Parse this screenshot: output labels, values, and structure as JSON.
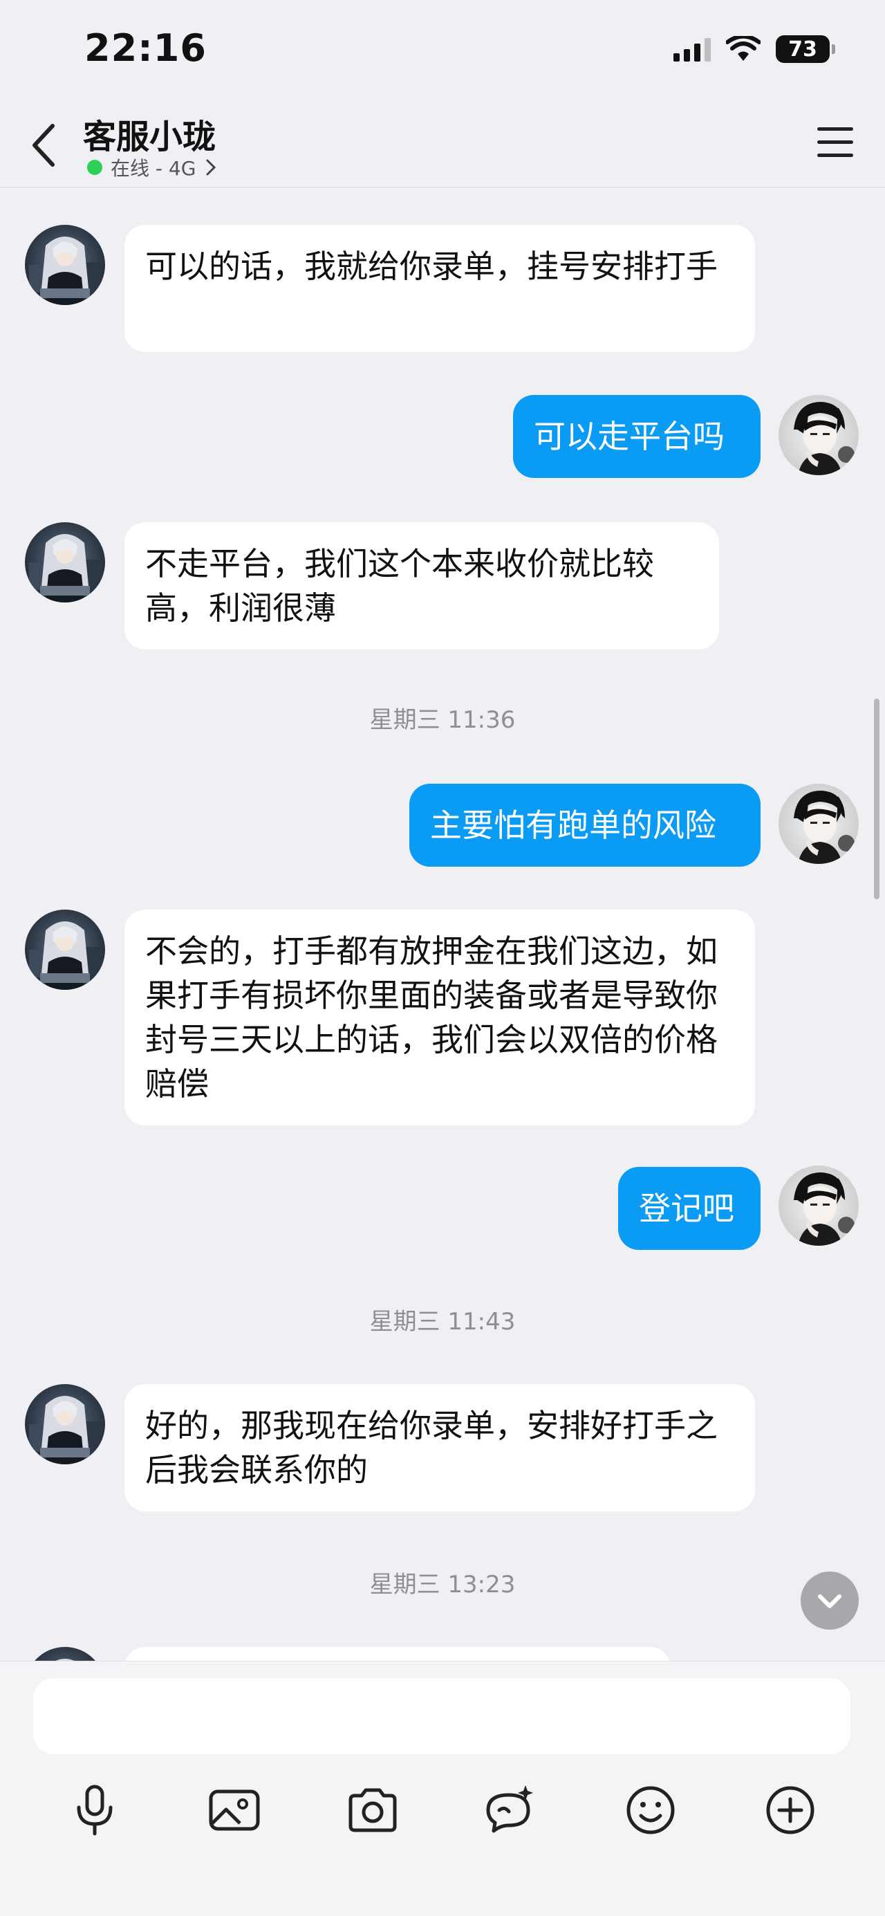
{
  "status_bar": {
    "time": "22:16",
    "battery": "73"
  },
  "header": {
    "title": "客服小珑",
    "status": "在线 - 4G"
  },
  "messages": [
    {
      "side": "in",
      "text": "可以的话，我就给你录单，挂号安排打手"
    },
    {
      "side": "out",
      "text": "可以走平台吗"
    },
    {
      "side": "in",
      "text": "不走平台，我们这个本来收价就比较高，利润很薄"
    },
    {
      "side": "time",
      "text": "星期三 11:36"
    },
    {
      "side": "out",
      "text": "主要怕有跑单的风险"
    },
    {
      "side": "in",
      "text": "不会的，打手都有放押金在我们这边，如果打手有损坏你里面的装备或者是导致你封号三天以上的话，我们会以双倍的价格赔偿"
    },
    {
      "side": "out",
      "text": "登记吧"
    },
    {
      "side": "time",
      "text": "星期三 11:43"
    },
    {
      "side": "in",
      "text": "好的，那我现在给你录单，安排好打手之后我会联系你的"
    },
    {
      "side": "time",
      "text": "星期三 13:23"
    }
  ],
  "input": {
    "placeholder": ""
  },
  "toolbar": [
    "microphone-icon",
    "image-icon",
    "camera-icon",
    "ai-assistant-icon",
    "emoji-icon",
    "plus-icon"
  ],
  "colors": {
    "outgoing_bubble": "#0a9bf5",
    "incoming_bubble": "#ffffff",
    "background": "#efeff4",
    "online": "#2ed158"
  }
}
